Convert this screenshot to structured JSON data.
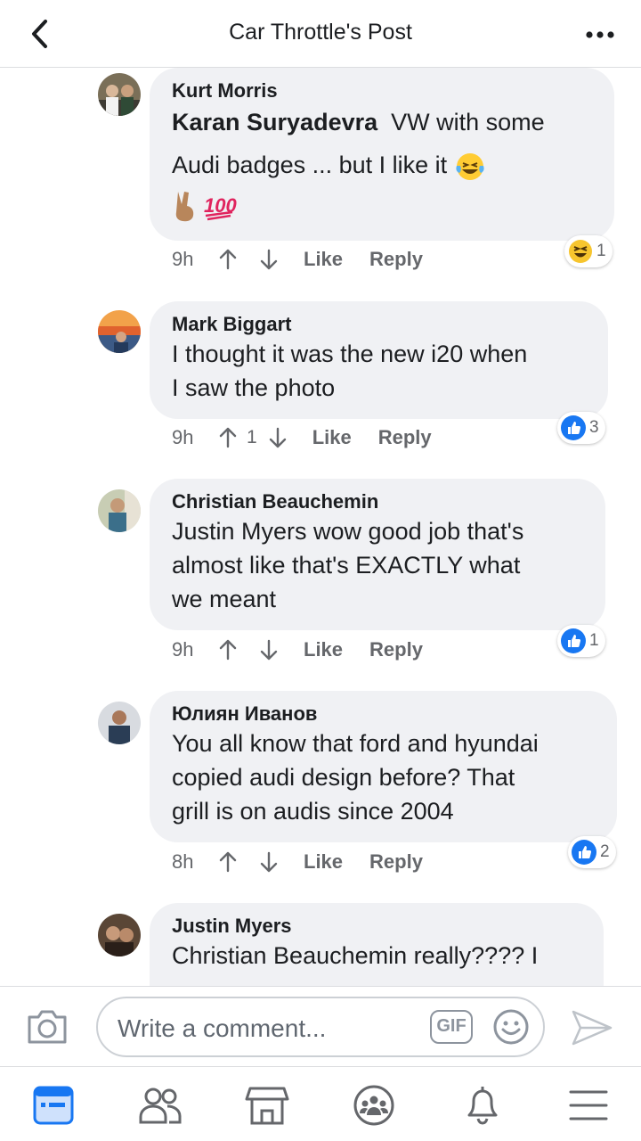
{
  "header": {
    "title": "Car Throttle's Post"
  },
  "comments": [
    {
      "author": "Kurt Morris",
      "mention": "Karan Suryadevra",
      "text_line1": "VW with some",
      "text_line2": "Audi badges ... but I like it",
      "time": "9h",
      "vote_count": "",
      "like_label": "Like",
      "reply_label": "Reply",
      "reaction_icon": "laughing-emoji",
      "reaction_count": "1"
    },
    {
      "author": "Mark Biggart",
      "text": "I thought it was the new i20 when I saw the photo",
      "text_line1": "I thought it was the new i20 when",
      "text_line2": "I saw the photo",
      "time": "9h",
      "vote_count": "1",
      "like_label": "Like",
      "reply_label": "Reply",
      "reaction_icon": "thumbs-up",
      "reaction_count": "3"
    },
    {
      "author": "Christian Beauchemin",
      "text_line1": "Justin Myers wow good job that's",
      "text_line2": "almost like that's EXACTLY what",
      "text_line3": "we meant",
      "time": "9h",
      "vote_count": "",
      "like_label": "Like",
      "reply_label": "Reply",
      "reaction_icon": "thumbs-up",
      "reaction_count": "1"
    },
    {
      "author": "Юлиян Иванов",
      "text_line1": "You all know that ford and hyundai",
      "text_line2": "copied audi design before? That",
      "text_line3": "grill is on audis since 2004",
      "time": "8h",
      "vote_count": "",
      "like_label": "Like",
      "reply_label": "Reply",
      "reaction_icon": "thumbs-up",
      "reaction_count": "2"
    },
    {
      "author": "Justin Myers",
      "text_line1": "Christian Beauchemin really???? I"
    }
  ],
  "composer": {
    "placeholder": "Write a comment...",
    "gif_label": "GIF"
  },
  "colors": {
    "accent": "#1877f2",
    "bubble": "#f0f1f4",
    "muted": "#65676b"
  },
  "nav": [
    "news-feed-icon",
    "friends-icon",
    "marketplace-icon",
    "groups-icon",
    "notifications-icon",
    "menu-icon"
  ]
}
